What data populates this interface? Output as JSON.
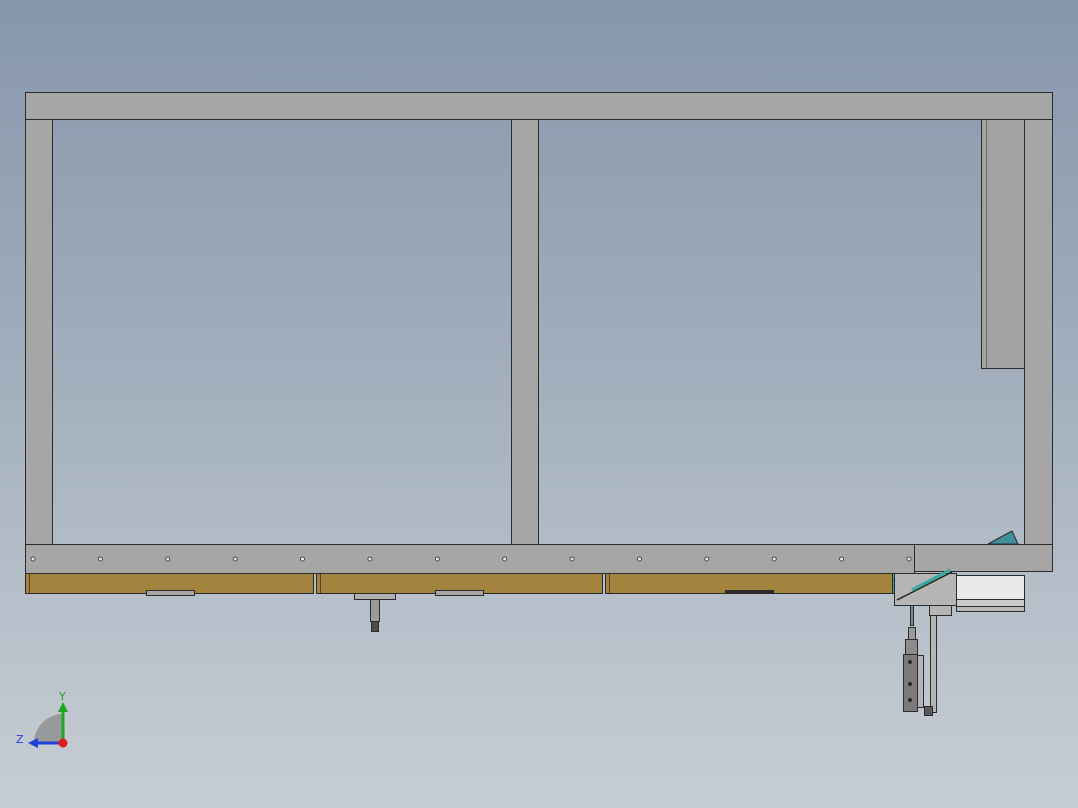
{
  "scene": {
    "background_top": "#8797ab",
    "background_bottom": "#c7cdd4",
    "frame_color": "#a6a6a6",
    "frame_edge": "#2b2b2b",
    "wood_color": "#a3843f",
    "accent_teal": "#3aa89a",
    "plate_hole_count": 14
  },
  "triad": {
    "y_label": "Y",
    "z_label": "Z",
    "y_color": "#1fa51f",
    "z_color": "#1f3fd6",
    "x_color": "#e01b1b"
  }
}
